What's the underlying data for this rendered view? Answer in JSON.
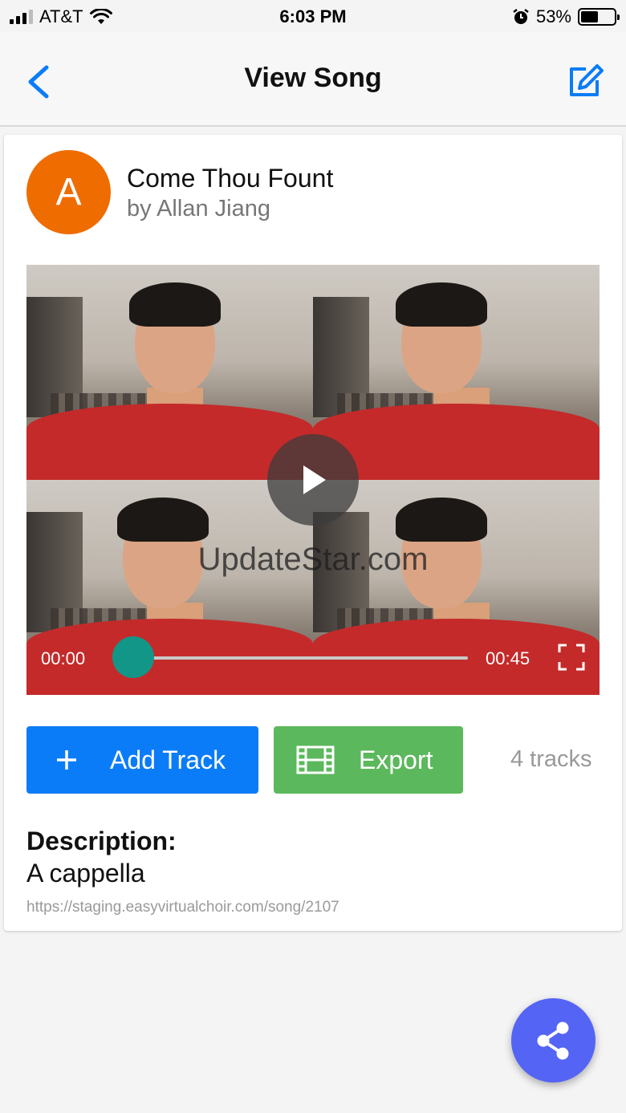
{
  "status_bar": {
    "carrier": "AT&T",
    "time": "6:03 PM",
    "battery": "53%",
    "battery_level": 0.53,
    "icons": [
      "signal-icon",
      "wifi-icon",
      "alarm-icon",
      "battery-icon"
    ]
  },
  "navbar": {
    "title": "View Song",
    "back_icon": "chevron-left-icon",
    "edit_icon": "edit-icon",
    "accent_color": "#0b7cf7"
  },
  "song": {
    "avatar_letter": "A",
    "avatar_color": "#ef6c00",
    "title": "Come Thou Fount",
    "author": "by Allan Jiang"
  },
  "video": {
    "watermark": "UpdateStar.com",
    "time_start": "00:00",
    "time_end": "00:45",
    "progress": 0,
    "play_icon": "play-icon",
    "fullscreen_icon": "fullscreen-icon",
    "tiles": 4
  },
  "actions": {
    "add_track_label": "Add Track",
    "add_track_color": "#0b7cf7",
    "export_label": "Export",
    "export_color": "#5cb85c",
    "track_count": "4 tracks"
  },
  "description": {
    "label": "Description:",
    "text": "A cappella",
    "url": "https://staging.easyvirtualchoir.com/song/2107"
  },
  "fab": {
    "icon": "share-icon",
    "color": "#5464f5"
  }
}
